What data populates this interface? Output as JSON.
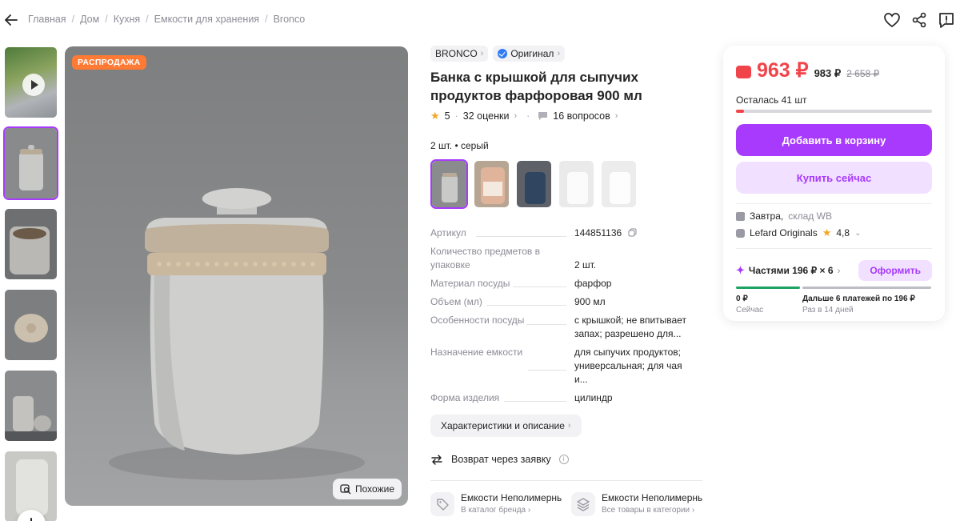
{
  "breadcrumbs": [
    "Главная",
    "Дом",
    "Кухня",
    "Емкости для хранения",
    "Bronco"
  ],
  "gallery": {
    "sale_badge": "РАСПРОДАЖА",
    "similar_label": "Похожие"
  },
  "product": {
    "brand": "BRONCO",
    "original_label": "Оригинал",
    "title": "Банка с крышкой для сыпучих продуктов фарфоровая 900 мл",
    "rating": "5",
    "reviews": "32 оценки",
    "questions": "16 вопросов",
    "variant": "2 шт. • серый"
  },
  "specs": [
    {
      "key": "Артикул",
      "value": "144851136"
    },
    {
      "key": "Количество предметов в упаковке",
      "value": "2 шт."
    },
    {
      "key": "Материал посуды",
      "value": "фарфор"
    },
    {
      "key": "Объем (мл)",
      "value": "900 мл"
    },
    {
      "key": "Особенности посуды",
      "value": "с крышкой; не впитывает запах; разрешено для..."
    },
    {
      "key": "Назначение емкости",
      "value": "для сыпучих продуктов; универсальная; для чая и..."
    },
    {
      "key": "Форма изделия",
      "value": "цилиндр"
    }
  ],
  "desc_button": "Характеристики и описание",
  "return_text": "Возврат через заявку",
  "categories": [
    {
      "title": "Емкости Неполимерные",
      "sub": "В каталог бренда"
    },
    {
      "title": "Емкости Неполимерные",
      "sub": "Все товары в категории"
    }
  ],
  "buy": {
    "price": "963 ₽",
    "price_wb": "983 ₽",
    "price_old": "2 658 ₽",
    "left": "Осталась 41 шт",
    "stock_fraction": 0.04,
    "add_to_cart": "Добавить в корзину",
    "buy_now": "Купить сейчас",
    "delivery_day": "Завтра,",
    "delivery_where": "склад WB",
    "seller": "Lefard Originals",
    "seller_rating": "4,8",
    "parts_label": "Частями 196 ₽ × 6",
    "order_button": "Оформить",
    "now_amount": "0 ₽",
    "now_label": "Сейчас",
    "later_amount": "Дальше 6 платежей по 196 ₽",
    "later_label": "Раз в 14 дней"
  },
  "colors": {
    "accent": "#a73afd",
    "price": "#f0444a",
    "badge": "#ff7a34"
  }
}
